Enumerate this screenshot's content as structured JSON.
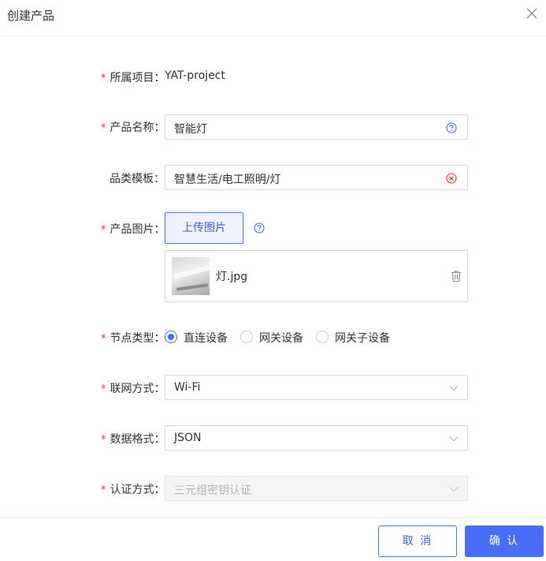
{
  "dialog": {
    "title": "创建产品",
    "cancel_label": "取 消",
    "confirm_label": "确 认"
  },
  "colors": {
    "accent": "#4a6cf7",
    "required": "#e8363c",
    "error_icon": "#e8363c"
  },
  "form": {
    "required_mark": "*",
    "project": {
      "label": "所属项目：",
      "value": "YAT-project"
    },
    "product_name": {
      "label": "产品名称：",
      "value": "智能灯",
      "icon": "help-circle-icon"
    },
    "category_template": {
      "label": "品类模板：",
      "value": "智慧生活/电工照明/灯",
      "icon": "clear-circle-icon"
    },
    "product_image": {
      "label": "产品图片：",
      "upload_label": "上传图片",
      "file_name": "灯.jpg",
      "icon": "help-circle-icon"
    },
    "node_type": {
      "label": "节点类型：",
      "options": [
        "直连设备",
        "网关设备",
        "网关子设备"
      ],
      "selected": "直连设备"
    },
    "network": {
      "label": "联网方式：",
      "value": "Wi-Fi"
    },
    "data_format": {
      "label": "数据格式：",
      "value": "JSON"
    },
    "auth": {
      "label": "认证方式：",
      "value": "三元组密钥认证",
      "disabled": true
    }
  }
}
